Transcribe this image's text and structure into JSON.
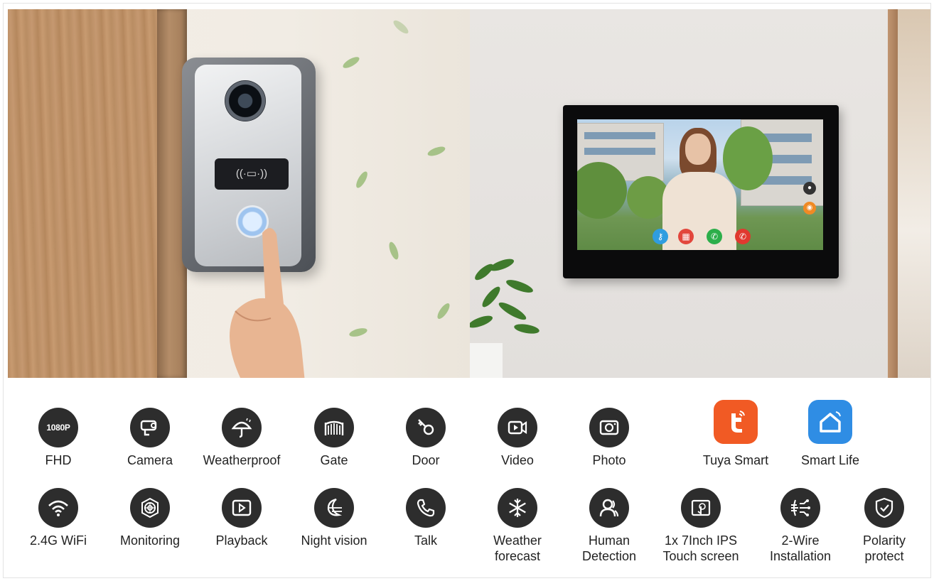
{
  "features_row1": [
    {
      "icon": "1080p-icon",
      "badge": "1080P",
      "label": "FHD"
    },
    {
      "icon": "camera-icon",
      "label": "Camera"
    },
    {
      "icon": "weatherproof-umbrella-icon",
      "label": "Weatherproof"
    },
    {
      "icon": "gate-icon",
      "label": "Gate"
    },
    {
      "icon": "door-key-icon",
      "label": "Door"
    },
    {
      "icon": "video-icon",
      "label": "Video"
    },
    {
      "icon": "photo-icon",
      "label": "Photo"
    },
    {
      "icon": "tuya-smart-icon",
      "label": "Tuya Smart"
    },
    {
      "icon": "smart-life-icon",
      "label": "Smart Life"
    }
  ],
  "features_row2": [
    {
      "icon": "wifi-icon",
      "label": "2.4G WiFi"
    },
    {
      "icon": "monitoring-icon",
      "label": "Monitoring"
    },
    {
      "icon": "playback-icon",
      "label": "Playback"
    },
    {
      "icon": "night-vision-icon",
      "label": "Night vision"
    },
    {
      "icon": "talk-phone-icon",
      "label": "Talk"
    },
    {
      "icon": "weather-forecast-snowflake-icon",
      "label_line1": "Weather",
      "label_line2": "forecast"
    },
    {
      "icon": "human-detection-icon",
      "label_line1": "Human",
      "label_line2": "Detection"
    },
    {
      "icon": "touch-screen-icon",
      "label_line1": "1x 7Inch IPS",
      "label_line2": "Touch screen"
    },
    {
      "icon": "two-wire-icon",
      "label_line1": "2-Wire",
      "label_line2": "Installation"
    },
    {
      "icon": "polarity-shield-icon",
      "label_line1": "Polarity",
      "label_line2": "protect"
    }
  ],
  "colors": {
    "icon_bg": "#2d2d2d",
    "tuya_orange": "#f15a24",
    "smart_life_blue": "#2f8de4"
  }
}
